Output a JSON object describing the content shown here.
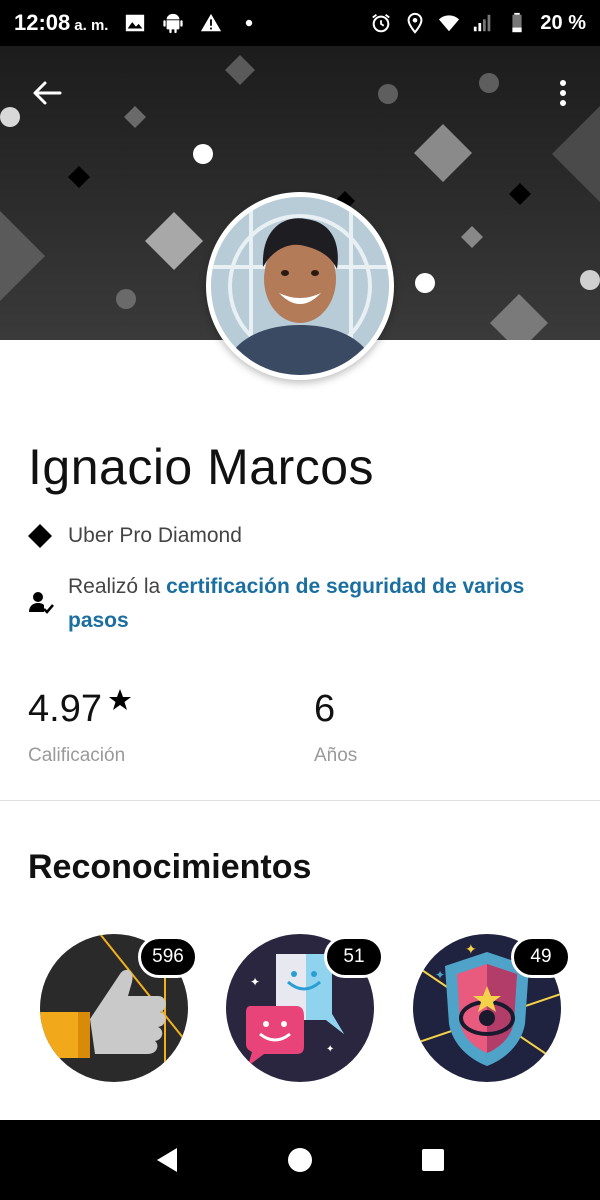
{
  "status_bar": {
    "time": "12:08",
    "ampm": "a. m.",
    "battery": "20 %",
    "icons_left": [
      "image-icon",
      "android-icon",
      "warning-icon",
      "dot-icon"
    ],
    "icons_right": [
      "alarm-icon",
      "location-icon",
      "wifi-icon",
      "signal-icon",
      "battery-icon"
    ]
  },
  "header": {
    "back_icon": "arrow-left-icon",
    "menu_icon": "more-vertical-icon"
  },
  "profile": {
    "name": "Ignacio Marcos",
    "tier": "Uber Pro Diamond",
    "certification_prefix": "Realizó la ",
    "certification_link": "certificación de seguridad de varios pasos"
  },
  "stats": [
    {
      "value": "4.97",
      "label": "Calificación",
      "icon": "star-icon"
    },
    {
      "value": "6",
      "label": "Años"
    }
  ],
  "recognitions": {
    "title": "Reconocimientos",
    "badges": [
      {
        "name": "thumbs-up-badge",
        "count": "596"
      },
      {
        "name": "conversation-badge",
        "count": "51"
      },
      {
        "name": "shield-badge",
        "count": "49"
      }
    ]
  },
  "colors": {
    "link": "#1a6fa0",
    "header_bg": "#2a2a2a",
    "badge_bg": "#2b2640"
  }
}
